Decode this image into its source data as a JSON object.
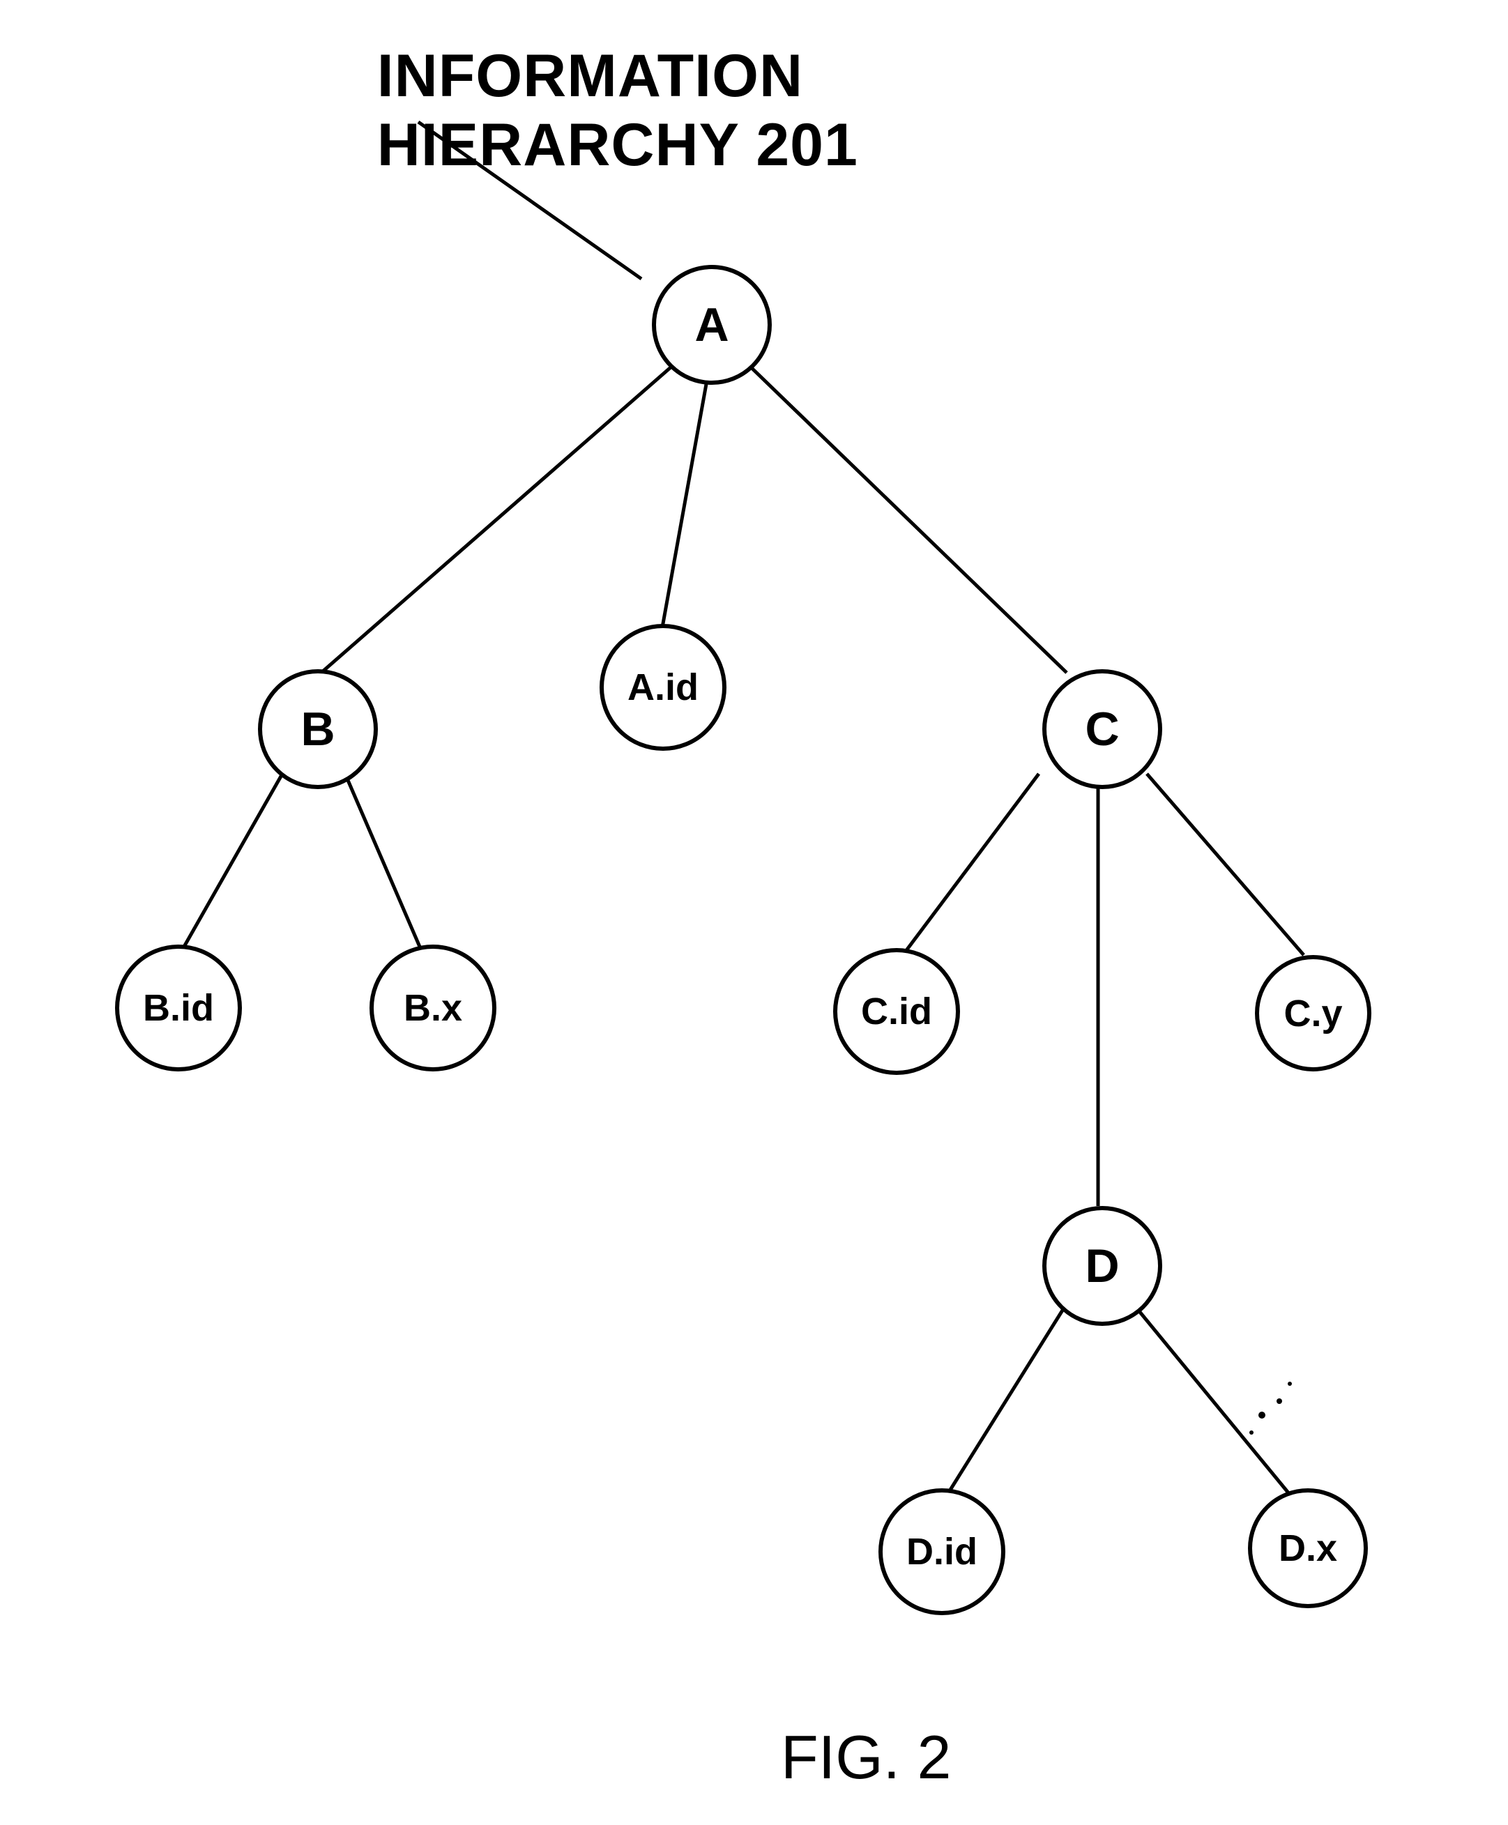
{
  "title": "INFORMATION HIERARCHY 201",
  "figure_label": "FIG. 2",
  "nodes": {
    "A": "A",
    "B": "B",
    "C": "C",
    "D": "D",
    "Aid": "A.id",
    "Bid": "B.id",
    "Bx": "B.x",
    "Cid": "C.id",
    "Cy": "C.y",
    "Did": "D.id",
    "Dx": "D.x"
  }
}
